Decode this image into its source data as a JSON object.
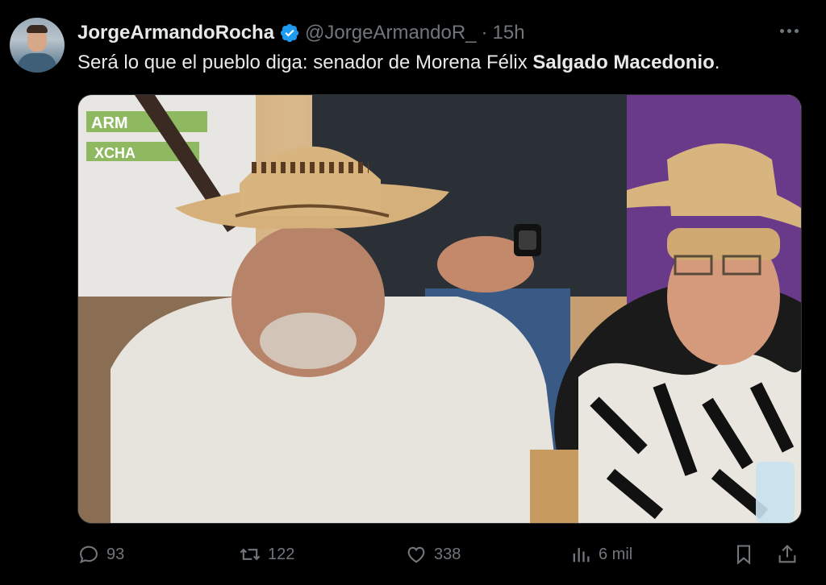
{
  "tweet": {
    "display_name": "JorgeArmandoRocha",
    "handle": "@JorgeArmandoR_",
    "separator": "·",
    "time": "15h",
    "text_plain": "Será lo que el pueblo diga: senador de Morena Félix ",
    "text_bold": "Salgado Macedonio",
    "text_end": "."
  },
  "media": {
    "overlay_text_1": "ARM",
    "overlay_text_2": "XCHA"
  },
  "actions": {
    "replies": "93",
    "retweets": "122",
    "likes": "338",
    "views": "6 mil"
  },
  "colors": {
    "background": "#000000",
    "text": "#e7e9ea",
    "muted": "#71767b",
    "verified": "#1d9bf0"
  }
}
